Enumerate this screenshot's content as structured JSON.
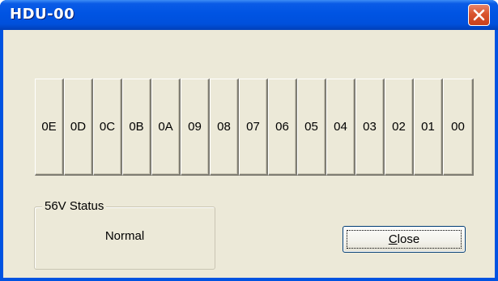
{
  "window": {
    "title": "HDU-00",
    "accent": "#0054e3",
    "close_icon": "close-x-icon"
  },
  "units": [
    "0E",
    "0D",
    "0C",
    "0B",
    "0A",
    "09",
    "08",
    "07",
    "06",
    "05",
    "04",
    "03",
    "02",
    "01",
    "00"
  ],
  "status": {
    "label": "56V Status",
    "value": "Normal"
  },
  "close_button": {
    "mnemonic": "C",
    "rest": "lose"
  }
}
